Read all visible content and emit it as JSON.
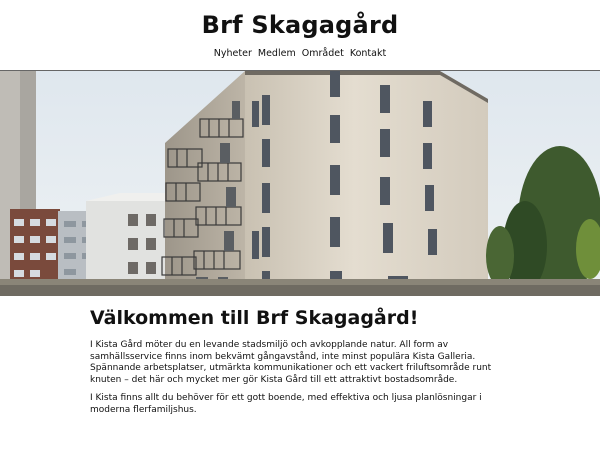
{
  "site": {
    "title": "Brf Skagagård"
  },
  "nav": {
    "items": [
      "Nyheter",
      "Medlem",
      "Området",
      "Kontakt"
    ]
  },
  "main": {
    "heading": "Välkommen till Brf Skagagård!",
    "paragraphs": [
      "I Kista Gård möter du en levande stadsmiljö och avkopplande natur. All form av samhällsservice finns inom bekvämt gångavstånd, inte minst populära Kista Galleria. Spännande arbetsplatser, utmärkta kommunikationer och ett vackert friluftsområde runt knuten – det här och mycket mer gör Kista Gård till ett attraktivt bostadsområde.",
      "I Kista finns allt du behöver för ett gott boende, med effektiva och ljusa planlösningar i moderna flerfamiljshus."
    ]
  },
  "colors": {
    "text": "#111111",
    "background": "#ffffff",
    "facade": "#d9d2c5",
    "sky": "#e6ecf1"
  }
}
